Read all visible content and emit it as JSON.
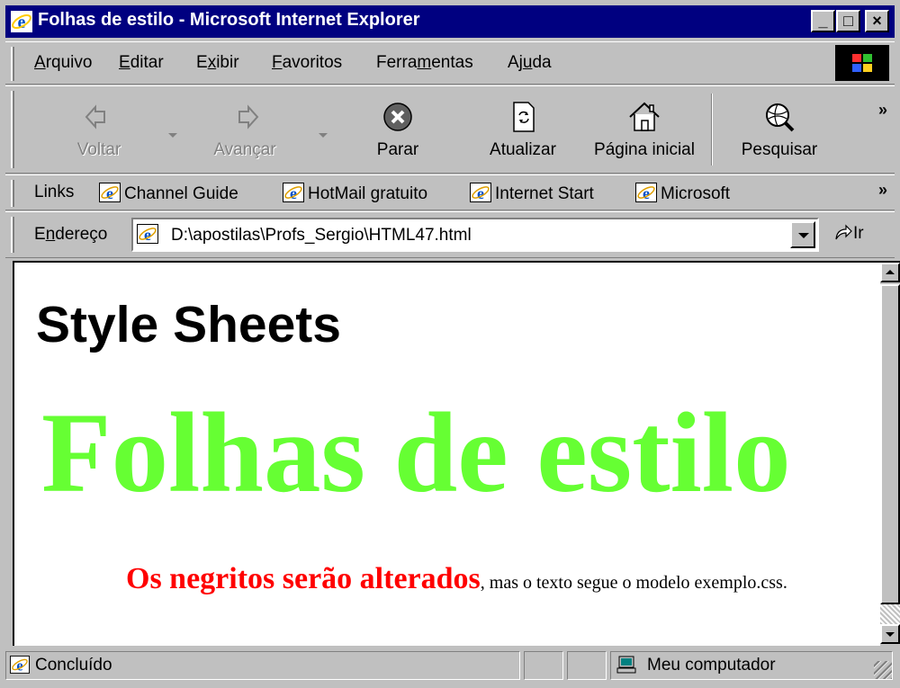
{
  "window": {
    "title": "Folhas de estilo - Microsoft Internet Explorer",
    "controls": {
      "minimize": "_",
      "maximize": "□",
      "close": "×"
    }
  },
  "menubar": {
    "items": [
      {
        "label": "Arquivo",
        "accel": "A",
        "rest": "rquivo"
      },
      {
        "label": "Editar",
        "accel": "E",
        "rest": "ditar"
      },
      {
        "label": "Exibir",
        "pre": "E",
        "accel": "x",
        "rest": "ibir"
      },
      {
        "label": "Favoritos",
        "accel": "F",
        "rest": "avoritos"
      },
      {
        "label": "Ferramentas",
        "pre": "Ferra",
        "accel": "m",
        "rest": "entas"
      },
      {
        "label": "Ajuda",
        "pre": "Aj",
        "accel": "u",
        "rest": "da"
      }
    ]
  },
  "toolbar": {
    "back": "Voltar",
    "forward": "Avançar",
    "stop": "Parar",
    "refresh": "Atualizar",
    "home": "Página inicial",
    "search": "Pesquisar",
    "more": "»"
  },
  "links": {
    "label": "Links",
    "items": [
      "Channel Guide",
      "HotMail gratuito",
      "Internet Start",
      "Microsoft"
    ],
    "more": "»"
  },
  "address": {
    "label_pre": "E",
    "label_accel": "n",
    "label_rest": "dereço",
    "value": "D:\\apostilas\\Profs_Sergio\\HTML47.html",
    "go": "Ir"
  },
  "page": {
    "heading_en": "Style Sheets",
    "heading_pt": "Folhas de estilo",
    "bold_text": "Os negritos serão alterados",
    "rest_text": ", mas o texto segue o modelo exemplo.css."
  },
  "status": {
    "text": "Concluído",
    "zone": "Meu computador"
  },
  "colors": {
    "titlebar": "#000080",
    "chrome": "#c0c0c0",
    "heading_pt": "#66ff33",
    "bold_text": "#ff0000"
  }
}
